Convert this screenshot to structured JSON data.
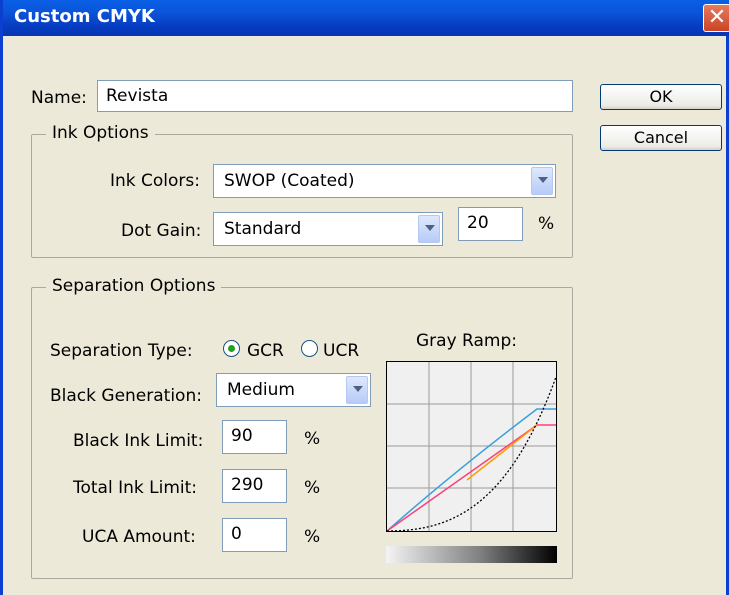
{
  "dialog": {
    "title": "Custom CMYK",
    "close_symbol": "✕"
  },
  "name": {
    "label": "Name:",
    "value": "Revista"
  },
  "buttons": {
    "ok": "OK",
    "cancel": "Cancel"
  },
  "ink_options": {
    "legend": "Ink Options",
    "ink_colors_label": "Ink Colors:",
    "ink_colors_value": "SWOP (Coated)",
    "dot_gain_label": "Dot Gain:",
    "dot_gain_value": "Standard",
    "dot_gain_amount": "20",
    "percent": "%"
  },
  "separation_options": {
    "legend": "Separation Options",
    "separation_type_label": "Separation Type:",
    "gcr_label": "GCR",
    "ucr_label": "UCR",
    "selected_type": "GCR",
    "black_generation_label": "Black Generation:",
    "black_generation_value": "Medium",
    "black_ink_limit_label": "Black Ink Limit:",
    "black_ink_limit_value": "90",
    "total_ink_limit_label": "Total Ink Limit:",
    "total_ink_limit_value": "290",
    "uca_amount_label": "UCA Amount:",
    "uca_amount_value": "0",
    "percent": "%"
  },
  "gray_ramp": {
    "label": "Gray Ramp:",
    "colors": {
      "cyan": "#3aa0d8",
      "magenta": "#ff3f7a",
      "yellow": "#ff9a00",
      "black": "#000000"
    }
  }
}
